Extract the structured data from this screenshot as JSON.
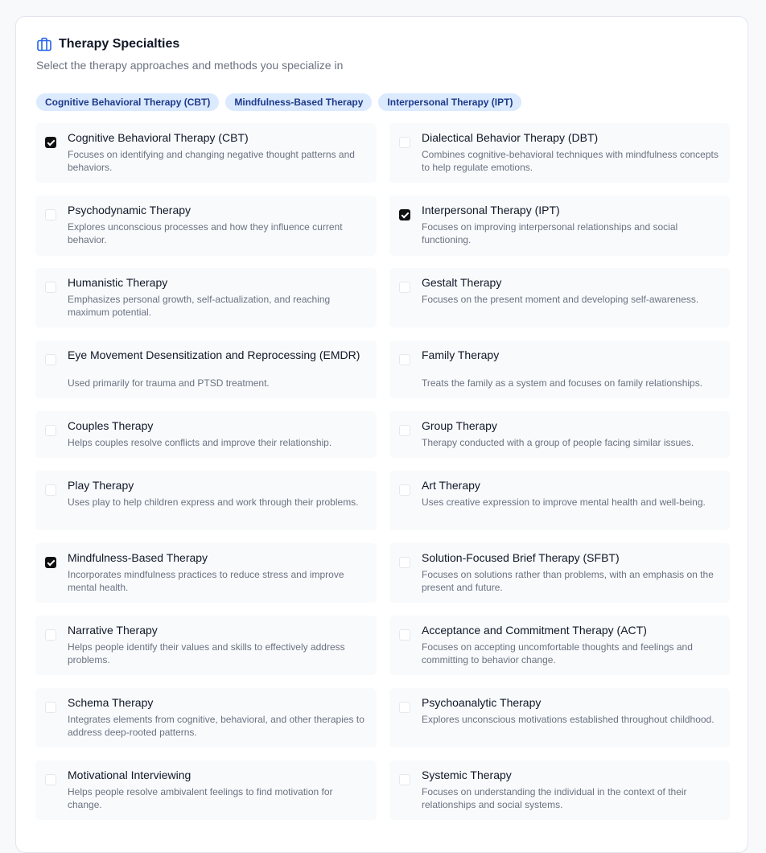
{
  "section": {
    "title": "Therapy Specialties",
    "subtitle": "Select the therapy approaches and methods you specialize in",
    "icon": "briefcase-icon",
    "accent_color": "#2563eb"
  },
  "selected_chips": [
    "Cognitive Behavioral Therapy (CBT)",
    "Mindfulness-Based Therapy",
    "Interpersonal Therapy (IPT)"
  ],
  "options": [
    {
      "label": "Cognitive Behavioral Therapy (CBT)",
      "description": "Focuses on identifying and changing negative thought patterns and behaviors.",
      "checked": true
    },
    {
      "label": "Dialectical Behavior Therapy (DBT)",
      "description": "Combines cognitive-behavioral techniques with mindfulness concepts to help regulate emotions.",
      "checked": false
    },
    {
      "label": "Psychodynamic Therapy",
      "description": "Explores unconscious processes and how they influence current behavior.",
      "checked": false
    },
    {
      "label": "Interpersonal Therapy (IPT)",
      "description": "Focuses on improving interpersonal relationships and social functioning.",
      "checked": true
    },
    {
      "label": "Humanistic Therapy",
      "description": "Emphasizes personal growth, self-actualization, and reaching maximum potential.",
      "checked": false
    },
    {
      "label": "Gestalt Therapy",
      "description": "Focuses on the present moment and developing self-awareness.",
      "checked": false
    },
    {
      "label": "Eye Movement Desensitization and Reprocessing (EMDR)",
      "description": "Used primarily for trauma and PTSD treatment.",
      "checked": false
    },
    {
      "label": "Family Therapy",
      "description": "Treats the family as a system and focuses on family relationships.",
      "checked": false
    },
    {
      "label": "Couples Therapy",
      "description": "Helps couples resolve conflicts and improve their relationship.",
      "checked": false
    },
    {
      "label": "Group Therapy",
      "description": "Therapy conducted with a group of people facing similar issues.",
      "checked": false
    },
    {
      "label": "Play Therapy",
      "description": "Uses play to help children express and work through their problems.",
      "checked": false
    },
    {
      "label": "Art Therapy",
      "description": "Uses creative expression to improve mental health and well-being.",
      "checked": false
    },
    {
      "label": "Mindfulness-Based Therapy",
      "description": "Incorporates mindfulness practices to reduce stress and improve mental health.",
      "checked": true
    },
    {
      "label": "Solution-Focused Brief Therapy (SFBT)",
      "description": "Focuses on solutions rather than problems, with an emphasis on the present and future.",
      "checked": false
    },
    {
      "label": "Narrative Therapy",
      "description": "Helps people identify their values and skills to effectively address problems.",
      "checked": false
    },
    {
      "label": "Acceptance and Commitment Therapy (ACT)",
      "description": "Focuses on accepting uncomfortable thoughts and feelings and committing to behavior change.",
      "checked": false
    },
    {
      "label": "Schema Therapy",
      "description": "Integrates elements from cognitive, behavioral, and other therapies to address deep-rooted patterns.",
      "checked": false
    },
    {
      "label": "Psychoanalytic Therapy",
      "description": "Explores unconscious motivations established throughout childhood.",
      "checked": false
    },
    {
      "label": "Motivational Interviewing",
      "description": "Helps people resolve ambivalent feelings to find motivation for change.",
      "checked": false
    },
    {
      "label": "Systemic Therapy",
      "description": "Focuses on understanding the individual in the context of their relationships and social systems.",
      "checked": false
    }
  ]
}
